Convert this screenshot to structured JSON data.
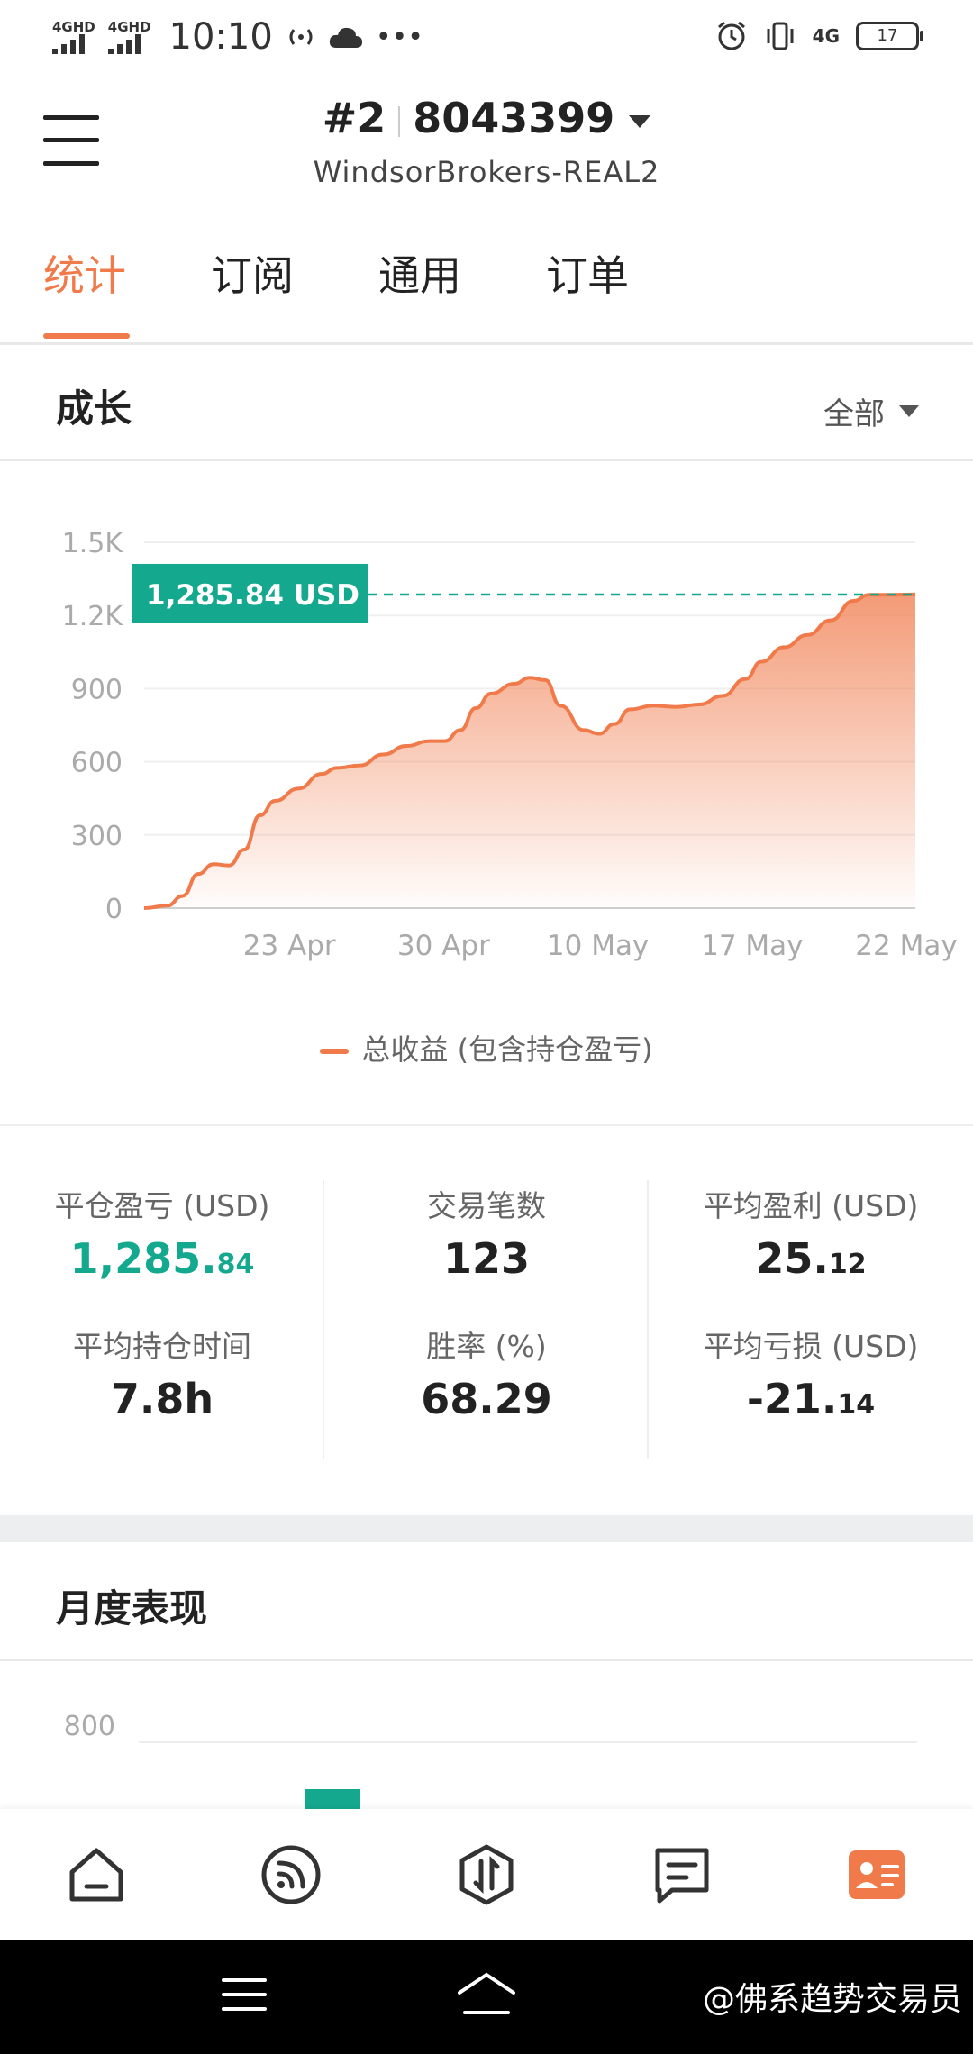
{
  "status_bar": {
    "sim1": "4GHD",
    "sim2": "4GHD",
    "time": "10:10",
    "network": "4G",
    "battery": "17"
  },
  "header": {
    "account_index": "#2",
    "account_number": "8043399",
    "server": "WindsorBrokers-REAL2"
  },
  "tabs": [
    {
      "label": "统计",
      "active": true
    },
    {
      "label": "订阅",
      "active": false
    },
    {
      "label": "通用",
      "active": false
    },
    {
      "label": "订单",
      "active": false
    }
  ],
  "growth": {
    "title": "成长",
    "filter_label": "全部",
    "current_value_label": "1,285.84 USD",
    "legend": "总收益 (包含持仓盈亏)"
  },
  "chart_data": {
    "type": "area",
    "x_tick_labels": [
      "23 Apr",
      "30 Apr",
      "10 May",
      "17 May",
      "22 May"
    ],
    "y_tick_labels": [
      "0",
      "300",
      "600",
      "900",
      "1.2K",
      "1.5K"
    ],
    "ylim": [
      0,
      1500
    ],
    "series": [
      {
        "name": "总收益 (包含持仓盈亏)",
        "color": "#f07a4a",
        "points": [
          [
            0,
            0
          ],
          [
            0.03,
            10
          ],
          [
            0.05,
            50
          ],
          [
            0.07,
            140
          ],
          [
            0.09,
            180
          ],
          [
            0.11,
            175
          ],
          [
            0.13,
            240
          ],
          [
            0.15,
            380
          ],
          [
            0.17,
            440
          ],
          [
            0.2,
            490
          ],
          [
            0.23,
            550
          ],
          [
            0.25,
            575
          ],
          [
            0.28,
            585
          ],
          [
            0.31,
            630
          ],
          [
            0.34,
            665
          ],
          [
            0.37,
            685
          ],
          [
            0.39,
            685
          ],
          [
            0.41,
            730
          ],
          [
            0.43,
            820
          ],
          [
            0.45,
            880
          ],
          [
            0.48,
            920
          ],
          [
            0.5,
            945
          ],
          [
            0.52,
            935
          ],
          [
            0.54,
            830
          ],
          [
            0.57,
            730
          ],
          [
            0.59,
            715
          ],
          [
            0.61,
            755
          ],
          [
            0.63,
            815
          ],
          [
            0.66,
            830
          ],
          [
            0.69,
            825
          ],
          [
            0.72,
            835
          ],
          [
            0.75,
            870
          ],
          [
            0.78,
            940
          ],
          [
            0.8,
            1010
          ],
          [
            0.83,
            1070
          ],
          [
            0.86,
            1120
          ],
          [
            0.89,
            1180
          ],
          [
            0.92,
            1260
          ],
          [
            0.94,
            1285
          ],
          [
            0.97,
            1285
          ],
          [
            1.0,
            1286
          ]
        ]
      }
    ],
    "current_value": 1285.84,
    "grid": true
  },
  "stats": [
    {
      "label": "平仓盈亏 (USD)",
      "value_main": "1,285.",
      "value_small": "84",
      "highlight": true
    },
    {
      "label": "交易笔数",
      "value_main": "123",
      "value_small": ""
    },
    {
      "label": "平均盈利 (USD)",
      "value_main": "25.",
      "value_small": "12"
    },
    {
      "label": "平均持仓时间",
      "value_main": "7.8h",
      "value_small": ""
    },
    {
      "label": "胜率 (%)",
      "value_main": "68.29",
      "value_small": ""
    },
    {
      "label": "平均亏损 (USD)",
      "value_main": "-21.",
      "value_small": "14"
    }
  ],
  "monthly": {
    "title": "月度表现",
    "y_tick_label": "800"
  },
  "bottom_nav": [
    {
      "icon": "home-icon",
      "active": false
    },
    {
      "icon": "signal-feed-icon",
      "active": false
    },
    {
      "icon": "trade-icon",
      "active": false
    },
    {
      "icon": "news-icon",
      "active": false
    },
    {
      "icon": "account-card-icon",
      "active": true
    }
  ],
  "watermark": "@佛系趋势交易员",
  "colors": {
    "accent": "#f07a4a",
    "green": "#14a88f"
  }
}
